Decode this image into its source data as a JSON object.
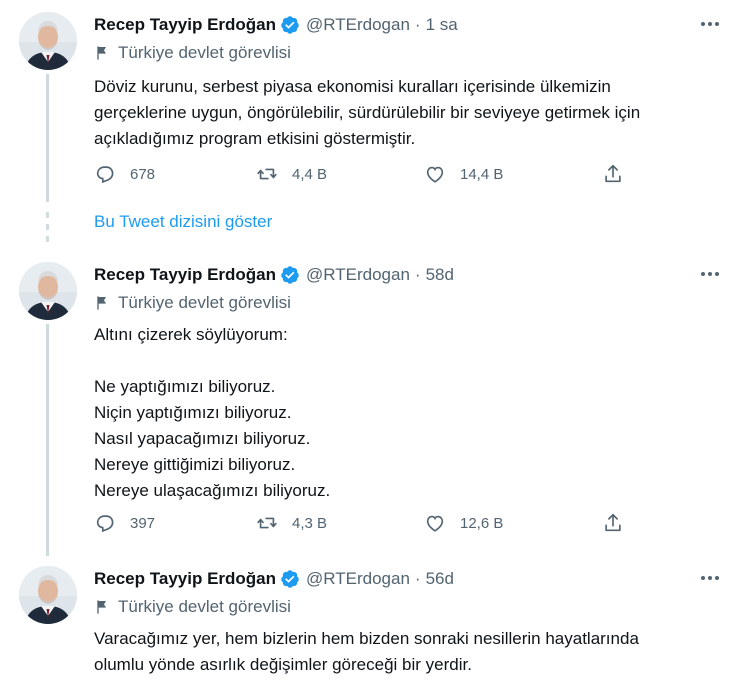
{
  "tweets": [
    {
      "name": "Recep Tayyip Erdoğan",
      "handle": "@RTErdogan",
      "time": "1 sa",
      "label": "Türkiye devlet görevlisi",
      "text": "Döviz kurunu, serbest piyasa ekonomisi kuralları içerisinde ülkemizin\ngerçeklerine uygun, öngörülebilir, sürdürülebilir bir seviyeye getirmek için\naçıkladığımız program etkisini göstermiştir.",
      "replies": "678",
      "retweets": "4,4 B",
      "likes": "14,4 B"
    },
    {
      "name": "Recep Tayyip Erdoğan",
      "handle": "@RTErdogan",
      "time": "58d",
      "label": "Türkiye devlet görevlisi",
      "text": "Altını çizerek söylüyorum:\n\nNe yaptığımızı biliyoruz.\nNiçin yaptığımızı biliyoruz.\nNasıl yapacağımızı biliyoruz.\nNereye gittiğimizi biliyoruz.\nNereye ulaşacağımızı biliyoruz.",
      "replies": "397",
      "retweets": "4,3 B",
      "likes": "12,6 B"
    },
    {
      "name": "Recep Tayyip Erdoğan",
      "handle": "@RTErdogan",
      "time": "56d",
      "label": "Türkiye devlet görevlisi",
      "text": "Varacağımız yer, hem bizlerin hem bizden sonraki nesillerin hayatlarında\nolumlu yönde asırlık değişimler göreceği bir yerdir."
    }
  ],
  "show_thread": "Bu Tweet dizisini göster",
  "colors": {
    "accent": "#1d9bf0",
    "muted": "#536471",
    "text": "#0f1419"
  },
  "icons": [
    "verified-badge-icon",
    "more-icon",
    "flag-icon",
    "reply-icon",
    "retweet-icon",
    "like-icon",
    "share-icon"
  ]
}
